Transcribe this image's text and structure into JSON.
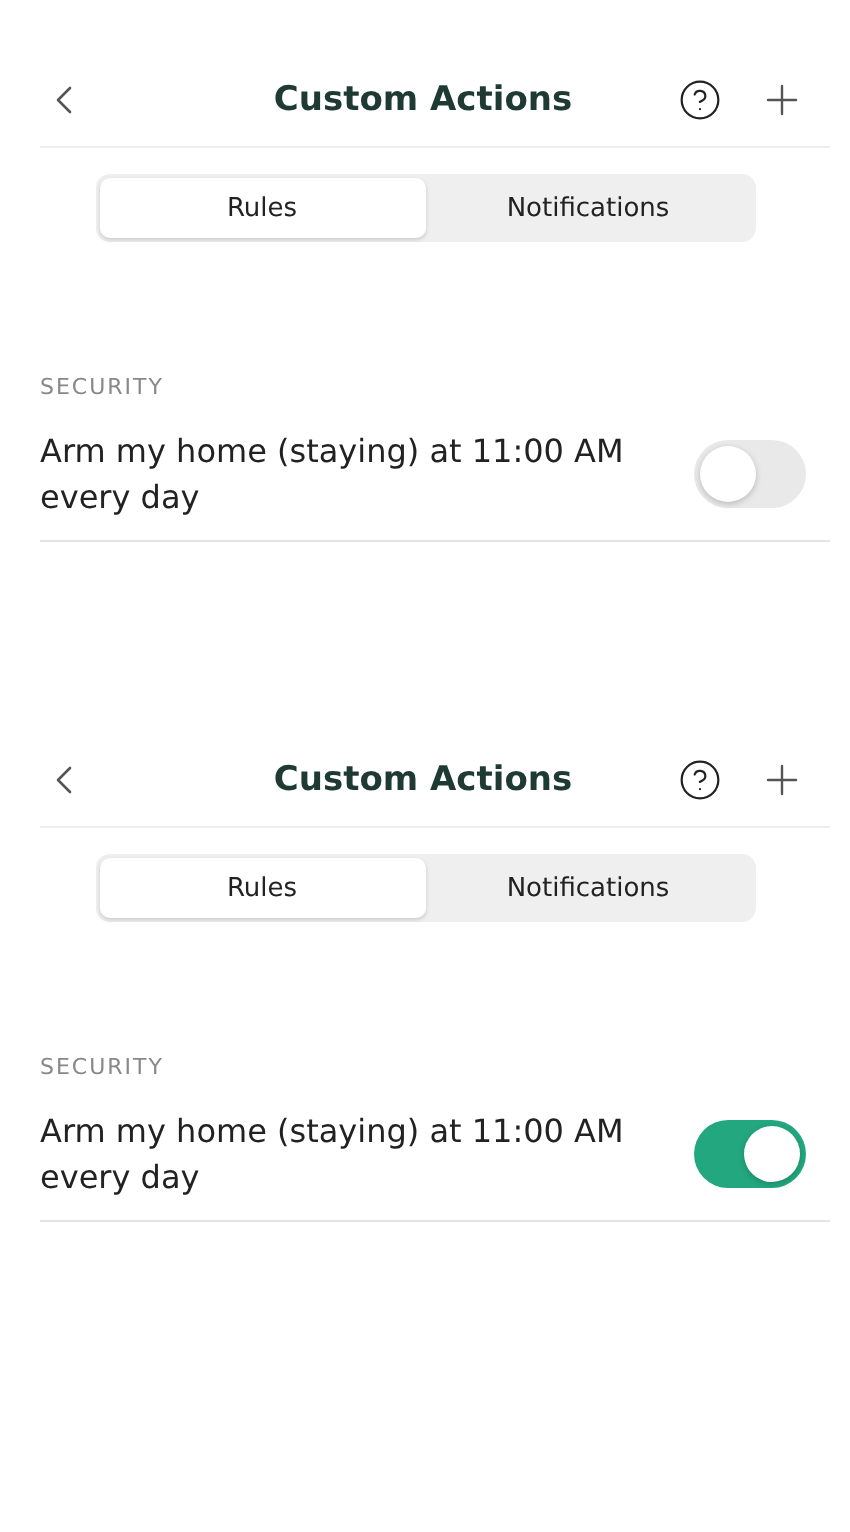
{
  "screens": [
    {
      "title": "Custom Actions",
      "tabs": [
        {
          "label": "Rules",
          "selected": true
        },
        {
          "label": "Notifications",
          "selected": false
        }
      ],
      "section": "SECURITY",
      "rules": [
        {
          "text": "Arm my home (staying) at 11:00 AM every day",
          "on": false
        }
      ]
    },
    {
      "title": "Custom Actions",
      "tabs": [
        {
          "label": "Rules",
          "selected": true
        },
        {
          "label": "Notifications",
          "selected": false
        }
      ],
      "section": "SECURITY",
      "rules": [
        {
          "text": "Arm my home (staying) at 11:00 AM every day",
          "on": true
        }
      ]
    }
  ]
}
